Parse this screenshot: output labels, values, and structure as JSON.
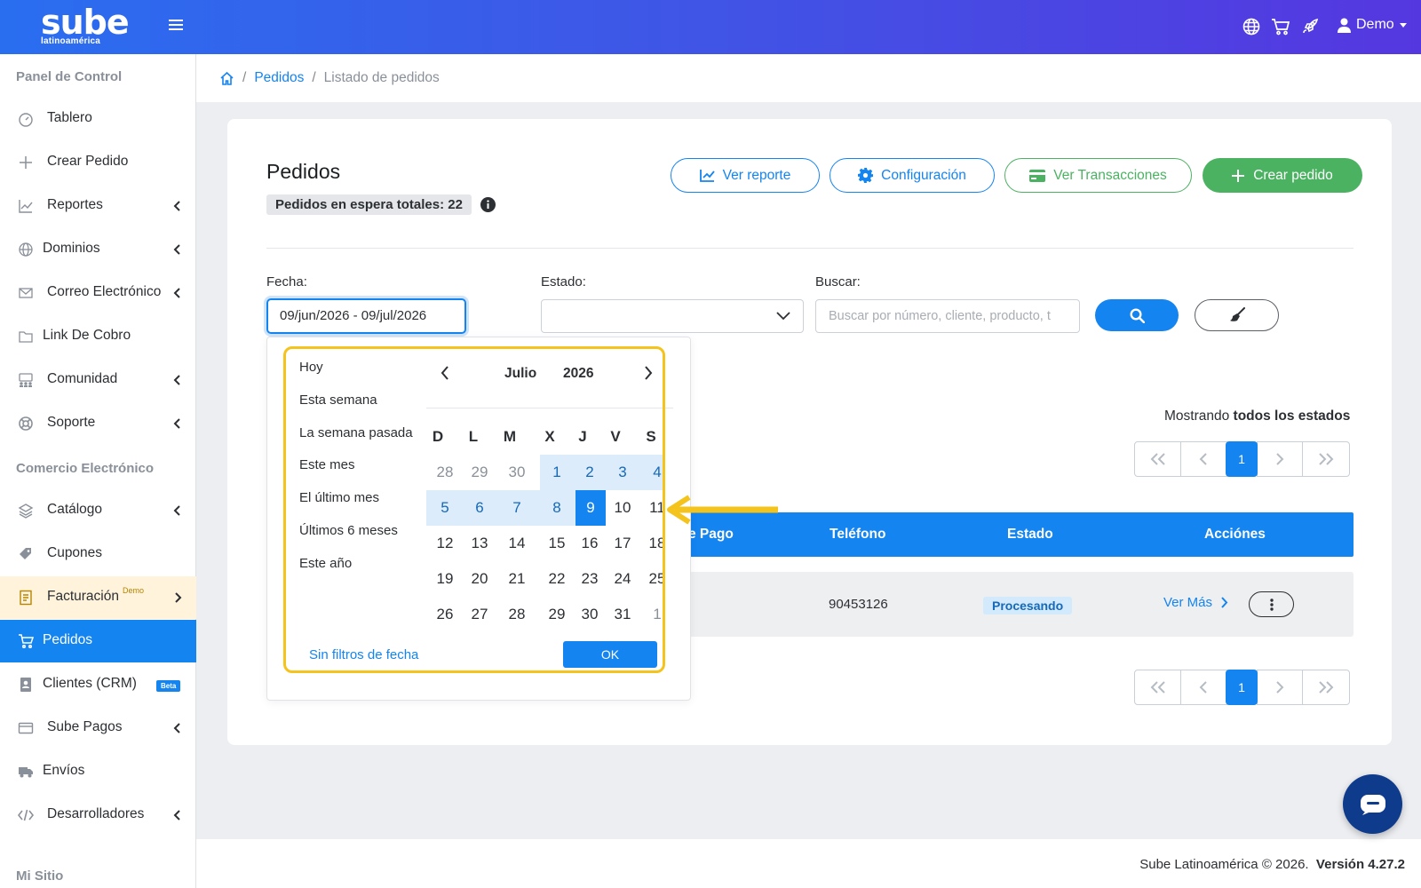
{
  "topbar": {
    "logo_main": "sube",
    "logo_sub": "latinoamérica",
    "user_label": "Demo"
  },
  "sidebar": {
    "sections": [
      "Panel de Control",
      "Comercio Electrónico",
      "Mi Sitio"
    ],
    "items": [
      {
        "label": "Tablero",
        "icon": "gauge-icon"
      },
      {
        "label": "Crear Pedido",
        "icon": "plus-icon"
      },
      {
        "label": "Reportes",
        "icon": "chart-line-icon",
        "expandable": true
      },
      {
        "label": "Dominios",
        "icon": "globe-icon",
        "expandable": true
      },
      {
        "label": "Correo Electrónico",
        "icon": "envelope-icon",
        "expandable": true
      },
      {
        "label": "Link De Cobro",
        "icon": "folder-icon"
      },
      {
        "label": "Comunidad",
        "icon": "community-icon",
        "expandable": true
      },
      {
        "label": "Soporte",
        "icon": "lifebuoy-icon",
        "expandable": true
      },
      {
        "label": "Catálogo",
        "icon": "layers-icon",
        "expandable": true
      },
      {
        "label": "Cupones",
        "icon": "tag-icon"
      },
      {
        "label": "Facturación",
        "badge": "Demo",
        "icon": "invoice-icon",
        "expandable": true
      },
      {
        "label": "Pedidos",
        "icon": "cart-icon",
        "active": true
      },
      {
        "label": "Clientes (CRM)",
        "badge": "Beta",
        "icon": "contact-book-icon"
      },
      {
        "label": "Sube Pagos",
        "icon": "credit-card-icon",
        "expandable": true
      },
      {
        "label": "Envíos",
        "icon": "truck-icon"
      },
      {
        "label": "Desarrolladores",
        "icon": "code-icon",
        "expandable": true
      }
    ]
  },
  "breadcrumb": {
    "link": "Pedidos",
    "current": "Listado de pedidos"
  },
  "page": {
    "title": "Pedidos",
    "pending_badge": "Pedidos en espera totales: 22",
    "buttons": {
      "report": "Ver reporte",
      "config": "Configuración",
      "transactions": "Ver Transacciones",
      "create": "Crear pedido"
    }
  },
  "filters": {
    "date_label": "Fecha:",
    "date_value": "09/jun/2026 - 09/jul/2026",
    "status_label": "Estado:",
    "status_value": "",
    "search_label": "Buscar:",
    "search_placeholder": "Buscar por número, cliente, producto, t"
  },
  "datepicker": {
    "presets": [
      "Hoy",
      "Esta semana",
      "La semana pasada",
      "Este mes",
      "El último mes",
      "Últimos 6 meses",
      "Este año"
    ],
    "month": "Julio",
    "year": "2026",
    "weekdays": [
      "D",
      "L",
      "M",
      "X",
      "J",
      "V",
      "S"
    ],
    "weeks": [
      [
        "28",
        "29",
        "30",
        "1",
        "2",
        "3",
        "4"
      ],
      [
        "5",
        "6",
        "7",
        "8",
        "9",
        "10",
        "11"
      ],
      [
        "12",
        "13",
        "14",
        "15",
        "16",
        "17",
        "18"
      ],
      [
        "19",
        "20",
        "21",
        "22",
        "23",
        "24",
        "25"
      ],
      [
        "26",
        "27",
        "28",
        "29",
        "30",
        "31",
        "1"
      ]
    ],
    "no_filter_label": "Sin filtros de fecha",
    "ok_label": "OK"
  },
  "list": {
    "showing_prefix": "Mostrando ",
    "showing_bold": "todos los estados",
    "pager": {
      "current": "1"
    },
    "columns": [
      "e Pago",
      "Teléfono",
      "Estado",
      "Acciónes"
    ],
    "rows": [
      {
        "phone": "90453126",
        "status": "Procesando",
        "action": "Ver Más"
      }
    ]
  },
  "footer": {
    "copyright": "Sube Latinoamérica © 2026.",
    "version": "Versión 4.27.2"
  },
  "colors": {
    "primary": "#1484f0",
    "success": "#4bb262",
    "highlight": "#f4c31c",
    "chat": "#0f3b8c"
  }
}
